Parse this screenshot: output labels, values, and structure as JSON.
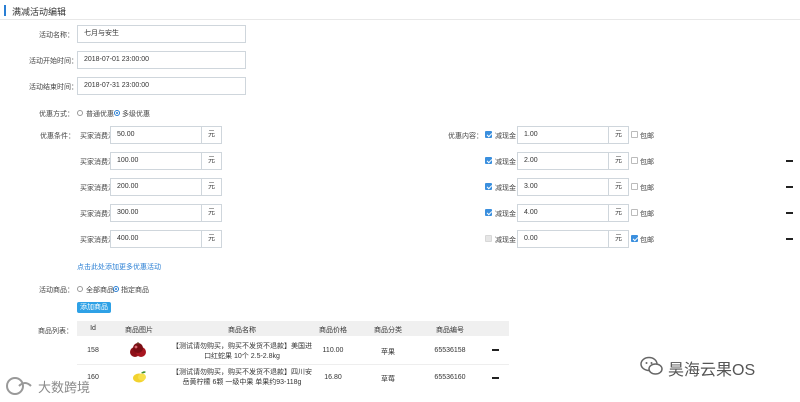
{
  "page": {
    "title": "满减活动编辑"
  },
  "form": {
    "name_label": "活动名称：",
    "name_value": "七月与安生",
    "start_label": "活动开始时间：",
    "start_value": "2018-07-01 23:00:00",
    "end_label": "活动结束时间：",
    "end_value": "2018-07-31 23:00:00",
    "type_label": "优惠方式：",
    "type_options": [
      "普通优惠",
      "多级优惠"
    ],
    "type_selected": "多级优惠",
    "condition_label": "优惠条件：",
    "content_label": "优惠内容：",
    "tiers": [
      {
        "cond_label": "买家消费满",
        "cond_value": "50.00",
        "cond_unit": "元",
        "cash_checked": true,
        "cash_label": "减现金",
        "cash_value": "1.00",
        "cash_unit": "元",
        "ship_checked": false,
        "ship_label": "包邮",
        "removable": false
      },
      {
        "cond_label": "买家消费满",
        "cond_value": "100.00",
        "cond_unit": "元",
        "cash_checked": true,
        "cash_label": "减现金",
        "cash_value": "2.00",
        "cash_unit": "元",
        "ship_checked": false,
        "ship_label": "包邮",
        "removable": true
      },
      {
        "cond_label": "买家消费满",
        "cond_value": "200.00",
        "cond_unit": "元",
        "cash_checked": true,
        "cash_label": "减现金",
        "cash_value": "3.00",
        "cash_unit": "元",
        "ship_checked": false,
        "ship_label": "包邮",
        "removable": true
      },
      {
        "cond_label": "买家消费满",
        "cond_value": "300.00",
        "cond_unit": "元",
        "cash_checked": true,
        "cash_label": "减现金",
        "cash_value": "4.00",
        "cash_unit": "元",
        "ship_checked": false,
        "ship_label": "包邮",
        "removable": true
      },
      {
        "cond_label": "买家消费满",
        "cond_value": "400.00",
        "cond_unit": "元",
        "cash_checked": false,
        "cash_label": "减现金",
        "cash_value": "0.00",
        "cash_unit": "元",
        "ship_checked": true,
        "ship_label": "包邮",
        "removable": true
      }
    ],
    "add_more_link": "点击此处添加更多优惠活动",
    "goods_label": "活动商品：",
    "goods_options": [
      "全部商品",
      "指定商品"
    ],
    "goods_selected": "指定商品",
    "add_goods_button": "添加商品"
  },
  "table": {
    "label": "商品列表：",
    "headers": [
      "Id",
      "商品图片",
      "商品名称",
      "商品价格",
      "商品分类",
      "商品编号"
    ],
    "rows": [
      {
        "id": "158",
        "name_line1": "【测试请勿购买，购买不发货不退款】美国进",
        "name_line2": "口红蛇果 10个 2.5-2.8kg",
        "price": "110.00",
        "category": "苹果",
        "sku": "65536158"
      },
      {
        "id": "160",
        "name_line1": "【测试请勿购买，购买不发货不退款】四川安",
        "name_line2": "岳黄柠檬 6颗 一级中果 单果约93-118g",
        "price": "16.80",
        "category": "草莓",
        "sku": "65536160"
      }
    ]
  },
  "watermarks": {
    "left": "大数跨境",
    "right": "昊海云果OS"
  },
  "colors": {
    "accent": "#2a7fd4",
    "button": "#2ea1e6",
    "checkbox": "#3a8fde"
  }
}
